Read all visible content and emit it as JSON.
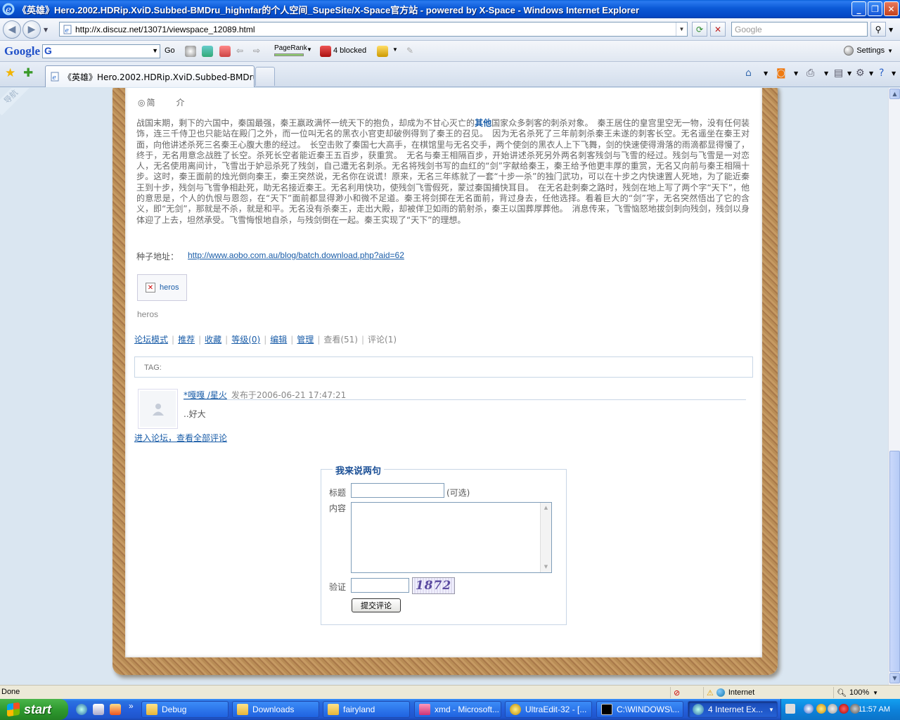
{
  "window": {
    "title": "《英雄》Hero.2002.HDRip.XviD.Subbed-BMDru_highnfar的个人空间_SupeSite/X-Space官方站 - powered by X-Space - Windows Internet Explorer",
    "minimize": "_",
    "maximize": "❐",
    "close": "✕"
  },
  "address_bar": {
    "url": "http://x.discuz.net/13071/viewspace_12089.html",
    "search_placeholder": "Google"
  },
  "google_toolbar": {
    "logo": "Google",
    "go_label": "Go",
    "pagerank_label": "PageRank",
    "blocked_label": "4 blocked",
    "settings_label": "Settings"
  },
  "tabs": [
    {
      "label": "《英雄》Hero.2002.HDRip.XviD.Subbed-BMDru_high..."
    }
  ],
  "page": {
    "side_tag": "导航",
    "intro_heading": "◎简　　介",
    "story_part1": "战国末期，剩下的六国中，秦国最强，秦王嬴政满怀一统天下的抱负，却成为不甘心灭亡的",
    "story_link": "其他",
    "story_part2": "国家众多刺客的刺杀对象。　秦王居住的皇宫里空无一物，没有任何装饰，连三千侍卫也只能站在殿门之外，而一位叫无名的黑衣小官吏却破例得到了秦王的召见。　因为无名杀死了三年前刺杀秦王未遂的刺客长空。无名遥坐在秦王对面，向他讲述杀死三名秦王心腹大患的经过。　长空击败了秦国七大高手，在棋馆里与无名交手，两个使剑的黑衣人上下飞舞，剑的快速使得滑落的雨滴都显得慢了，终于，无名用意念战胜了长空。杀死长空者能近秦王五百步，获重赏。　无名与秦王相隔百步，开始讲述杀死另外两名刺客残剑与飞雪的经过。残剑与飞雪是一对恋人，无名使用离间计，飞雪出于妒忌杀死了残剑，自己遭无名刺杀。无名将残剑书写的血红的“剑”字献给秦王，秦王给予他更丰厚的重赏，无名又向前与秦王相隔十步。这时，秦王面前的烛光倒向秦王，秦王突然说，无名你在说谎！原来，无名三年练就了一套“十步一杀”的独门武功，可以在十步之内快速置人死地，为了能近秦王到十步，残剑与飞雪争相赴死，助无名接近秦王。无名利用快功，使残剑飞雪假死，蒙过秦国捕快耳目。　在无名赴刺秦之路时，残剑在地上写了两个字“天下”，他的意思是，个人的仇恨与恩怨，在“天下”面前都显得渺小和微不足道。秦王将剑掷在无名面前，背过身去，任他选择。看着巨大的“剑”字，无名突然悟出了它的含义，即“无剑”，那就是不杀，就是和平。无名没有杀秦王，走出大殿，却被佯卫如雨的箭射杀，秦王以国葬厚葬他。　消息传来，飞雪恼怒地拔剑刺向残剑，残剑以身体迎了上去，坦然承受。飞雪悔恨地自杀，与残剑倒在一起。秦王实现了“天下”的理想。",
    "seed_label": "种子地址：",
    "seed_url": "http://www.aobo.com.au/blog/batch.download.php?aid=62",
    "attachment_name": "heros",
    "caption": "heros",
    "actions": {
      "forum_mode": "论坛模式",
      "recommend": "推荐",
      "favorite": "收藏",
      "rating": "等级(0)",
      "edit": "编辑",
      "manage": "管理",
      "views": "查看(51)",
      "comments": "评论(1)"
    },
    "tag_label": "TAG:",
    "comment": {
      "author": "*嘎嘎 /星火",
      "posted": "发布于2006-06-21 17:47:21",
      "body": "..好大"
    },
    "more_comments_link": "进入论坛，查看全部评论",
    "form": {
      "legend": "我来说两句",
      "title_label": "标题",
      "optional_label": "(可选)",
      "content_label": "内容",
      "verify_label": "验证",
      "captcha_text": "1872",
      "submit_label": "提交评论"
    }
  },
  "status_bar": {
    "status": "Done",
    "zone": "Internet",
    "zoom": "100%"
  },
  "taskbar": {
    "start_label": "start",
    "quicklaunch_more": "»",
    "buttons": [
      {
        "label": "Debug"
      },
      {
        "label": "Downloads"
      },
      {
        "label": "fairyland"
      },
      {
        "label": "xmd - Microsoft..."
      },
      {
        "label": "UltraEdit-32 - [..."
      },
      {
        "label": "C:\\WINDOWS\\..."
      },
      {
        "label": "4 Internet Ex..."
      }
    ],
    "clock": "11:57 AM"
  },
  "colors": {
    "link": "#1a5da8",
    "titlebar": "#0b59d6",
    "taskbar": "#245fdc",
    "start_button": "#2f9a2f",
    "page_background": "#dae6f1"
  },
  "icons": [
    "ie-icon",
    "back-arrow-icon",
    "forward-arrow-icon",
    "refresh-icon",
    "stop-icon",
    "search-icon",
    "favorites-star-icon",
    "add-favorite-icon",
    "home-icon",
    "rss-feed-icon",
    "print-icon",
    "page-icon",
    "tools-icon",
    "help-icon",
    "broken-image-icon",
    "avatar-placeholder-icon",
    "folder-icon",
    "windows-flag-icon",
    "globe-icon",
    "zoom-icon"
  ]
}
